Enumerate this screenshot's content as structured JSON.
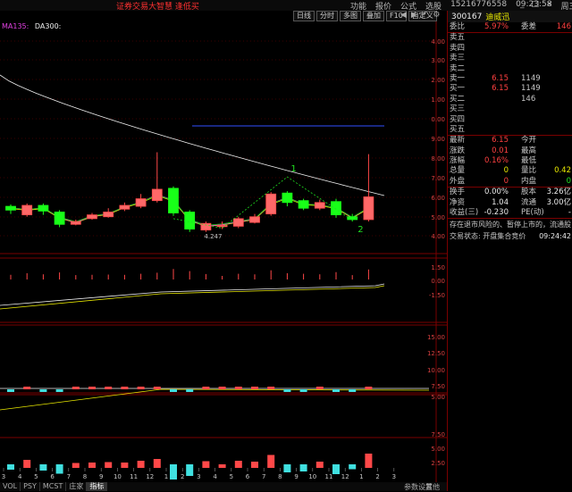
{
  "app": {
    "title": "证券交易大智慧  逢低买",
    "menu": [
      "功能",
      "报价",
      "公式",
      "选股",
      "15216776558",
      "09:23:58",
      "周三"
    ],
    "window_controls": [
      "_",
      "□",
      "×"
    ]
  },
  "toolbar": {
    "buttons": [
      "日线",
      "分时",
      "多图",
      "叠加",
      "F10",
      "自定义"
    ],
    "icons": [
      "◀",
      "▶",
      "↶",
      "⚙"
    ]
  },
  "ma_legend": {
    "ma1": "MA135:",
    "ma2": "DA300:"
  },
  "stock": {
    "code": "300167",
    "name": "迪威迅",
    "rows": [
      {
        "l": "委比",
        "v": "5.97%",
        "vc": "red",
        "l2": "委差",
        "v2": "146",
        "v2c": "red"
      },
      {
        "l": "卖五",
        "v": "",
        "vc": "white",
        "l2": "",
        "v2": "",
        "v2c": "white"
      },
      {
        "l": "卖四",
        "v": "",
        "vc": "white",
        "l2": "",
        "v2": "",
        "v2c": "white"
      },
      {
        "l": "卖三",
        "v": "",
        "vc": "white",
        "l2": "",
        "v2": "",
        "v2c": "white"
      },
      {
        "l": "卖二",
        "v": "",
        "vc": "white",
        "l2": "",
        "v2": "",
        "v2c": "white"
      },
      {
        "l": "卖一",
        "v": "6.15",
        "vc": "red",
        "l2": "1149",
        "v2": "",
        "v2c": "yellow"
      },
      {
        "l": "买一",
        "v": "6.15",
        "vc": "red",
        "l2": "1149",
        "v2": "",
        "v2c": "yellow"
      },
      {
        "l": "买二",
        "v": "",
        "vc": "white",
        "l2": "146",
        "v2": "",
        "v2c": "yellow"
      },
      {
        "l": "买三",
        "v": "",
        "vc": "white",
        "l2": "",
        "v2": "",
        "v2c": "white"
      },
      {
        "l": "买四",
        "v": "",
        "vc": "white",
        "l2": "",
        "v2": "",
        "v2c": "white"
      },
      {
        "l": "买五",
        "v": "",
        "vc": "white",
        "l2": "",
        "v2": "",
        "v2c": "white"
      },
      {
        "l": "最新",
        "v": "6.15",
        "vc": "red",
        "l2": "今开",
        "v2": "",
        "v2c": "white"
      },
      {
        "l": "涨跌",
        "v": "0.01",
        "vc": "red",
        "l2": "最高",
        "v2": "",
        "v2c": "white"
      },
      {
        "l": "涨幅",
        "v": "0.16%",
        "vc": "red",
        "l2": "最低",
        "v2": "",
        "v2c": "white"
      },
      {
        "l": "总量",
        "v": "0",
        "vc": "yellow",
        "l2": "量比",
        "v2": "0.42",
        "v2c": "yellow"
      },
      {
        "l": "外盘",
        "v": "0",
        "vc": "red",
        "l2": "内盘",
        "v2": "0",
        "v2c": "green"
      },
      {
        "l": "换手",
        "v": "0.00%",
        "vc": "white",
        "l2": "股本",
        "v2": "3.26亿",
        "v2c": "white"
      },
      {
        "l": "净资",
        "v": "1.04",
        "vc": "white",
        "l2": "流通",
        "v2": "3.00亿",
        "v2c": "white"
      },
      {
        "l": "收益(三)",
        "v": "-0.230",
        "vc": "white",
        "l2": "PE(动)",
        "v2": "-",
        "v2c": "white"
      }
    ],
    "notice1": "存在退市风险的、暂停上市的，流通股",
    "notice2": "交易状态: 开盘集合竞价",
    "notice_time": "09:24:42"
  },
  "price_axis": [
    "4.00",
    "3.00",
    "2.00",
    "1.00",
    "0.00",
    "9.00",
    "8.00",
    "7.00",
    "6.00",
    "5.00",
    "4.00"
  ],
  "vol_axis": [
    "1.50",
    "0.00",
    "-1.50"
  ],
  "macd_axis": [
    "15.00",
    "12.50",
    "10.00",
    "7.50",
    "5.00"
  ],
  "kdj_axis": [
    "7.50",
    "5.00",
    "2.50"
  ],
  "x_ticks": [
    "3",
    "4",
    "5",
    "6",
    "7",
    "8",
    "9",
    "10",
    "11",
    "12",
    "1",
    "2",
    "3",
    "4",
    "5",
    "6",
    "7",
    "8",
    "9",
    "10",
    "11",
    "12",
    "1",
    "2",
    "3"
  ],
  "annotations": {
    "wave1": "1",
    "wave2": "2",
    "low_label": "4.247"
  },
  "bottom_tabs": [
    "VOL",
    "PSY",
    "MCST",
    "庄家",
    "指标"
  ],
  "bottom_extra": [
    "参数设置",
    "其他"
  ],
  "colors": {
    "up": "#ff4848",
    "down": "#18ff18",
    "ma_white": "#f0f0f0",
    "ma_yellow": "#e8e800",
    "ma_magenta": "#e040e0",
    "ma_green": "#10c010",
    "grid_red": "#7a0000",
    "wave_green": "#20e020",
    "blue_line": "#3050ff"
  },
  "chart_data": {
    "type": "candlestick",
    "candles": [
      {
        "o": 5.55,
        "c": 5.35,
        "h": 5.65,
        "l": 5.15
      },
      {
        "o": 5.1,
        "c": 5.6,
        "h": 5.7,
        "l": 5.0
      },
      {
        "o": 5.6,
        "c": 5.3,
        "h": 5.7,
        "l": 5.1
      },
      {
        "o": 5.25,
        "c": 4.6,
        "h": 5.35,
        "l": 4.45
      },
      {
        "o": 4.6,
        "c": 4.75,
        "h": 4.85,
        "l": 4.55
      },
      {
        "o": 4.9,
        "c": 5.1,
        "h": 5.2,
        "l": 4.85
      },
      {
        "o": 5.0,
        "c": 5.25,
        "h": 5.45,
        "l": 4.95
      },
      {
        "o": 5.4,
        "c": 5.6,
        "h": 5.75,
        "l": 5.3
      },
      {
        "o": 5.55,
        "c": 5.95,
        "h": 6.2,
        "l": 5.45
      },
      {
        "o": 5.85,
        "c": 6.45,
        "h": 8.4,
        "l": 5.75
      },
      {
        "o": 6.5,
        "c": 5.2,
        "h": 6.6,
        "l": 5.05
      },
      {
        "o": 5.25,
        "c": 4.35,
        "h": 5.35,
        "l": 4.2
      },
      {
        "o": 4.3,
        "c": 4.65,
        "h": 4.75,
        "l": 4.2
      },
      {
        "o": 4.55,
        "c": 4.55,
        "h": 4.75,
        "l": 4.35
      },
      {
        "o": 4.5,
        "c": 4.9,
        "h": 5.0,
        "l": 4.4
      },
      {
        "o": 4.7,
        "c": 5.0,
        "h": 5.15,
        "l": 4.65
      },
      {
        "o": 5.15,
        "c": 6.2,
        "h": 6.3,
        "l": 5.05
      },
      {
        "o": 6.25,
        "c": 5.75,
        "h": 6.35,
        "l": 5.55
      },
      {
        "o": 5.85,
        "c": 5.45,
        "h": 5.95,
        "l": 5.35
      },
      {
        "o": 5.45,
        "c": 5.75,
        "h": 5.9,
        "l": 5.35
      },
      {
        "o": 5.8,
        "c": 5.1,
        "h": 5.95,
        "l": 4.95
      },
      {
        "o": 5.0,
        "c": 4.85,
        "h": 5.15,
        "l": 4.75
      },
      {
        "o": 4.85,
        "c": 6.05,
        "h": 8.3,
        "l": 4.75
      }
    ]
  }
}
